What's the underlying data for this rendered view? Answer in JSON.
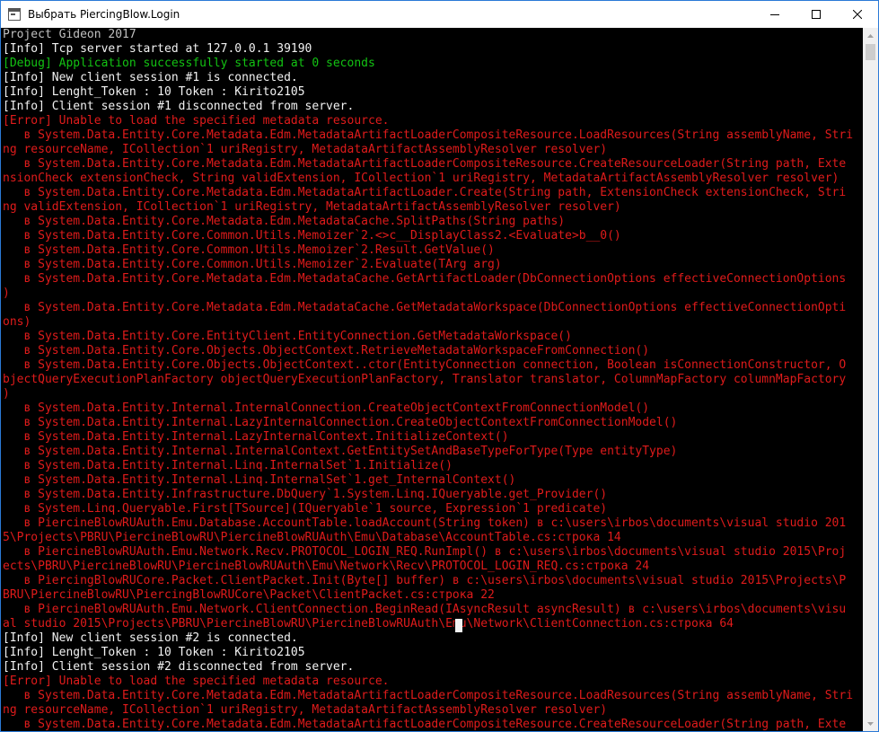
{
  "window": {
    "title": "Выбрать PiercingBlow.Login",
    "icon": "console-app-icon",
    "controls": [
      "minimize-icon",
      "maximize-icon",
      "close-icon"
    ]
  },
  "console": {
    "lines": [
      {
        "text": "Project Gideon 2017",
        "color": "gray"
      },
      {
        "text": "[Info] Tcp server started at 127.0.0.1 39190",
        "color": "white"
      },
      {
        "text": "[Debug] Application successfully started at 0 seconds",
        "color": "green"
      },
      {
        "text": "[Info] New client session #1 is connected.",
        "color": "white"
      },
      {
        "text": "[Info] Lenght_Token : 10 Token : Kirito2105",
        "color": "white"
      },
      {
        "text": "[Info] Client session #1 disconnected from server.",
        "color": "white"
      },
      {
        "text": "[Error] Unable to load the specified metadata resource.",
        "color": "red"
      },
      {
        "text": "   в System.Data.Entity.Core.Metadata.Edm.MetadataArtifactLoaderCompositeResource.LoadResources(String assemblyName, Stri",
        "color": "red"
      },
      {
        "text": "ng resourceName, ICollection`1 uriRegistry, MetadataArtifactAssemblyResolver resolver)",
        "color": "red"
      },
      {
        "text": "   в System.Data.Entity.Core.Metadata.Edm.MetadataArtifactLoaderCompositeResource.CreateResourceLoader(String path, Exte",
        "color": "red"
      },
      {
        "text": "nsionCheck extensionCheck, String validExtension, ICollection`1 uriRegistry, MetadataArtifactAssemblyResolver resolver)",
        "color": "red"
      },
      {
        "text": "   в System.Data.Entity.Core.Metadata.Edm.MetadataArtifactLoader.Create(String path, ExtensionCheck extensionCheck, Stri",
        "color": "red"
      },
      {
        "text": "ng validExtension, ICollection`1 uriRegistry, MetadataArtifactAssemblyResolver resolver)",
        "color": "red"
      },
      {
        "text": "   в System.Data.Entity.Core.Metadata.Edm.MetadataCache.SplitPaths(String paths)",
        "color": "red"
      },
      {
        "text": "   в System.Data.Entity.Core.Common.Utils.Memoizer`2.<>c__DisplayClass2.<Evaluate>b__0()",
        "color": "red"
      },
      {
        "text": "   в System.Data.Entity.Core.Common.Utils.Memoizer`2.Result.GetValue()",
        "color": "red"
      },
      {
        "text": "   в System.Data.Entity.Core.Common.Utils.Memoizer`2.Evaluate(TArg arg)",
        "color": "red"
      },
      {
        "text": "   в System.Data.Entity.Core.Metadata.Edm.MetadataCache.GetArtifactLoader(DbConnectionOptions effectiveConnectionOptions",
        "color": "red"
      },
      {
        "text": ")",
        "color": "red"
      },
      {
        "text": "   в System.Data.Entity.Core.Metadata.Edm.MetadataCache.GetMetadataWorkspace(DbConnectionOptions effectiveConnectionOpti",
        "color": "red"
      },
      {
        "text": "ons)",
        "color": "red"
      },
      {
        "text": "   в System.Data.Entity.Core.EntityClient.EntityConnection.GetMetadataWorkspace()",
        "color": "red"
      },
      {
        "text": "   в System.Data.Entity.Core.Objects.ObjectContext.RetrieveMetadataWorkspaceFromConnection()",
        "color": "red"
      },
      {
        "text": "   в System.Data.Entity.Core.Objects.ObjectContext..ctor(EntityConnection connection, Boolean isConnectionConstructor, O",
        "color": "red"
      },
      {
        "text": "bjectQueryExecutionPlanFactory objectQueryExecutionPlanFactory, Translator translator, ColumnMapFactory columnMapFactory",
        "color": "red"
      },
      {
        "text": ")",
        "color": "red"
      },
      {
        "text": "   в System.Data.Entity.Internal.InternalConnection.CreateObjectContextFromConnectionModel()",
        "color": "red"
      },
      {
        "text": "   в System.Data.Entity.Internal.LazyInternalConnection.CreateObjectContextFromConnectionModel()",
        "color": "red"
      },
      {
        "text": "   в System.Data.Entity.Internal.LazyInternalContext.InitializeContext()",
        "color": "red"
      },
      {
        "text": "   в System.Data.Entity.Internal.InternalContext.GetEntitySetAndBaseTypeForType(Type entityType)",
        "color": "red"
      },
      {
        "text": "   в System.Data.Entity.Internal.Linq.InternalSet`1.Initialize()",
        "color": "red"
      },
      {
        "text": "   в System.Data.Entity.Internal.Linq.InternalSet`1.get_InternalContext()",
        "color": "red"
      },
      {
        "text": "   в System.Data.Entity.Infrastructure.DbQuery`1.System.Linq.IQueryable.get_Provider()",
        "color": "red"
      },
      {
        "text": "   в System.Linq.Queryable.First[TSource](IQueryable`1 source, Expression`1 predicate)",
        "color": "red"
      },
      {
        "text": "   в PiercineBlowRUAuth.Emu.Database.AccountTable.loadAccount(String token) в c:\\users\\irbos\\documents\\visual studio 201",
        "color": "red"
      },
      {
        "text": "5\\Projects\\PBRU\\PiercineBlowRU\\PiercineBlowRUAuth\\Emu\\Database\\AccountTable.cs:строка 14",
        "color": "red"
      },
      {
        "text": "   в PiercineBlowRUAuth.Emu.Network.Recv.PROTOCOL_LOGIN_REQ.RunImpl() в c:\\users\\irbos\\documents\\visual studio 2015\\Proj",
        "color": "red"
      },
      {
        "text": "ects\\PBRU\\PiercineBlowRU\\PiercineBlowRUAuth\\Emu\\Network\\Recv\\PROTOCOL_LOGIN_REQ.cs:строка 24",
        "color": "red"
      },
      {
        "text": "   в PiercingBlowRUCore.Packet.ClientPacket.Init(Byte[] buffer) в c:\\users\\irbos\\documents\\visual studio 2015\\Projects\\P",
        "color": "red"
      },
      {
        "text": "BRU\\PiercineBlowRU\\PiercingBlowRUCore\\Packet\\ClientPacket.cs:строка 22",
        "color": "red"
      },
      {
        "text": "   в PiercineBlowRUAuth.Emu.Network.ClientConnection.BeginRead(IAsyncResult asyncResult) в c:\\users\\irbos\\documents\\visu",
        "color": "red"
      },
      {
        "text": "al studio 2015\\Projects\\PBRU\\PiercineBlowRU\\PiercineBlowRUAuth\\Emu\\Network\\ClientConnection.cs:строка 64",
        "color": "red"
      },
      {
        "text": "[Info] New client session #2 is connected.",
        "color": "white"
      },
      {
        "text": "[Info] Lenght_Token : 10 Token : Kirito2105",
        "color": "white"
      },
      {
        "text": "[Info] Client session #2 disconnected from server.",
        "color": "white"
      },
      {
        "text": "[Error] Unable to load the specified metadata resource.",
        "color": "red"
      },
      {
        "text": "   в System.Data.Entity.Core.Metadata.Edm.MetadataArtifactLoaderCompositeResource.LoadResources(String assemblyName, Stri",
        "color": "red"
      },
      {
        "text": "ng resourceName, ICollection`1 uriRegistry, MetadataArtifactAssemblyResolver resolver)",
        "color": "red"
      },
      {
        "text": "   в System.Data.Entity.Core.Metadata.Edm.MetadataArtifactLoaderCompositeResource.CreateResourceLoader(String path, Exte",
        "color": "red"
      }
    ]
  },
  "colors": {
    "background": "#000000",
    "info": "#f2f2f2",
    "debug": "#13c313",
    "error": "#e01b1b",
    "banner": "#c0c0c0",
    "window_border": "#2b79d6"
  }
}
